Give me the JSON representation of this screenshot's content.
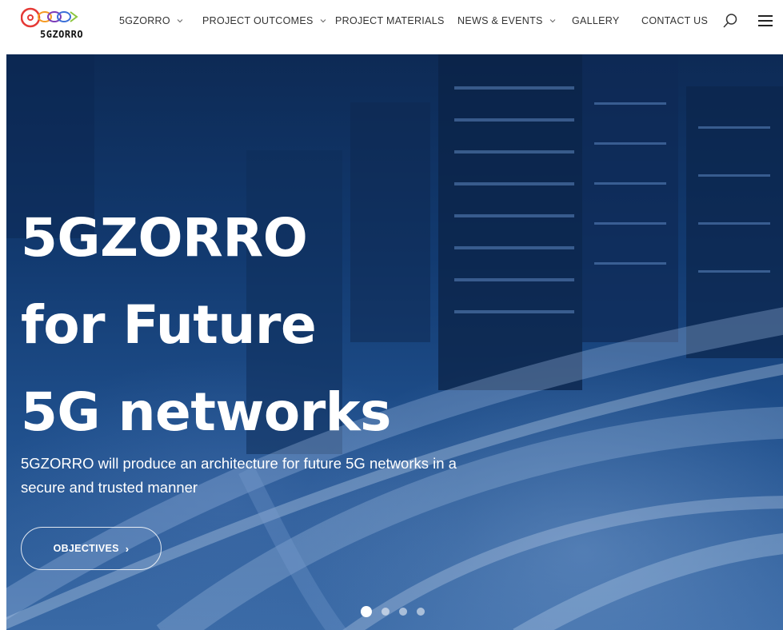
{
  "brand": {
    "logo_text": "5GZORRO"
  },
  "nav": {
    "items": [
      {
        "label": "5GZORRO",
        "has_dropdown": true
      },
      {
        "label": "PROJECT OUTCOMES",
        "has_dropdown": true
      },
      {
        "label": "PROJECT MATERIALS",
        "has_dropdown": false
      },
      {
        "label": "NEWS & EVENTS",
        "has_dropdown": true
      },
      {
        "label": "GALLERY",
        "has_dropdown": false
      },
      {
        "label": "CONTACT US",
        "has_dropdown": false
      }
    ],
    "icons": {
      "search": "search-icon",
      "menu": "hamburger-menu-icon"
    }
  },
  "hero": {
    "title": "5GZORRO\nfor Future\n5G networks",
    "subtitle": "5GZORRO will produce an architecture for future 5G networks in a secure and trusted manner",
    "button_label": "OBJECTIVES",
    "button_icon": "chevron-right-icon",
    "slides_total": 4,
    "active_slide": 1
  },
  "colors": {
    "logo_red": "#e53935",
    "logo_orange": "#f59a23",
    "logo_blue": "#3b6fd8",
    "logo_green": "#8cc63f",
    "hero_overlay": "#123a70"
  }
}
